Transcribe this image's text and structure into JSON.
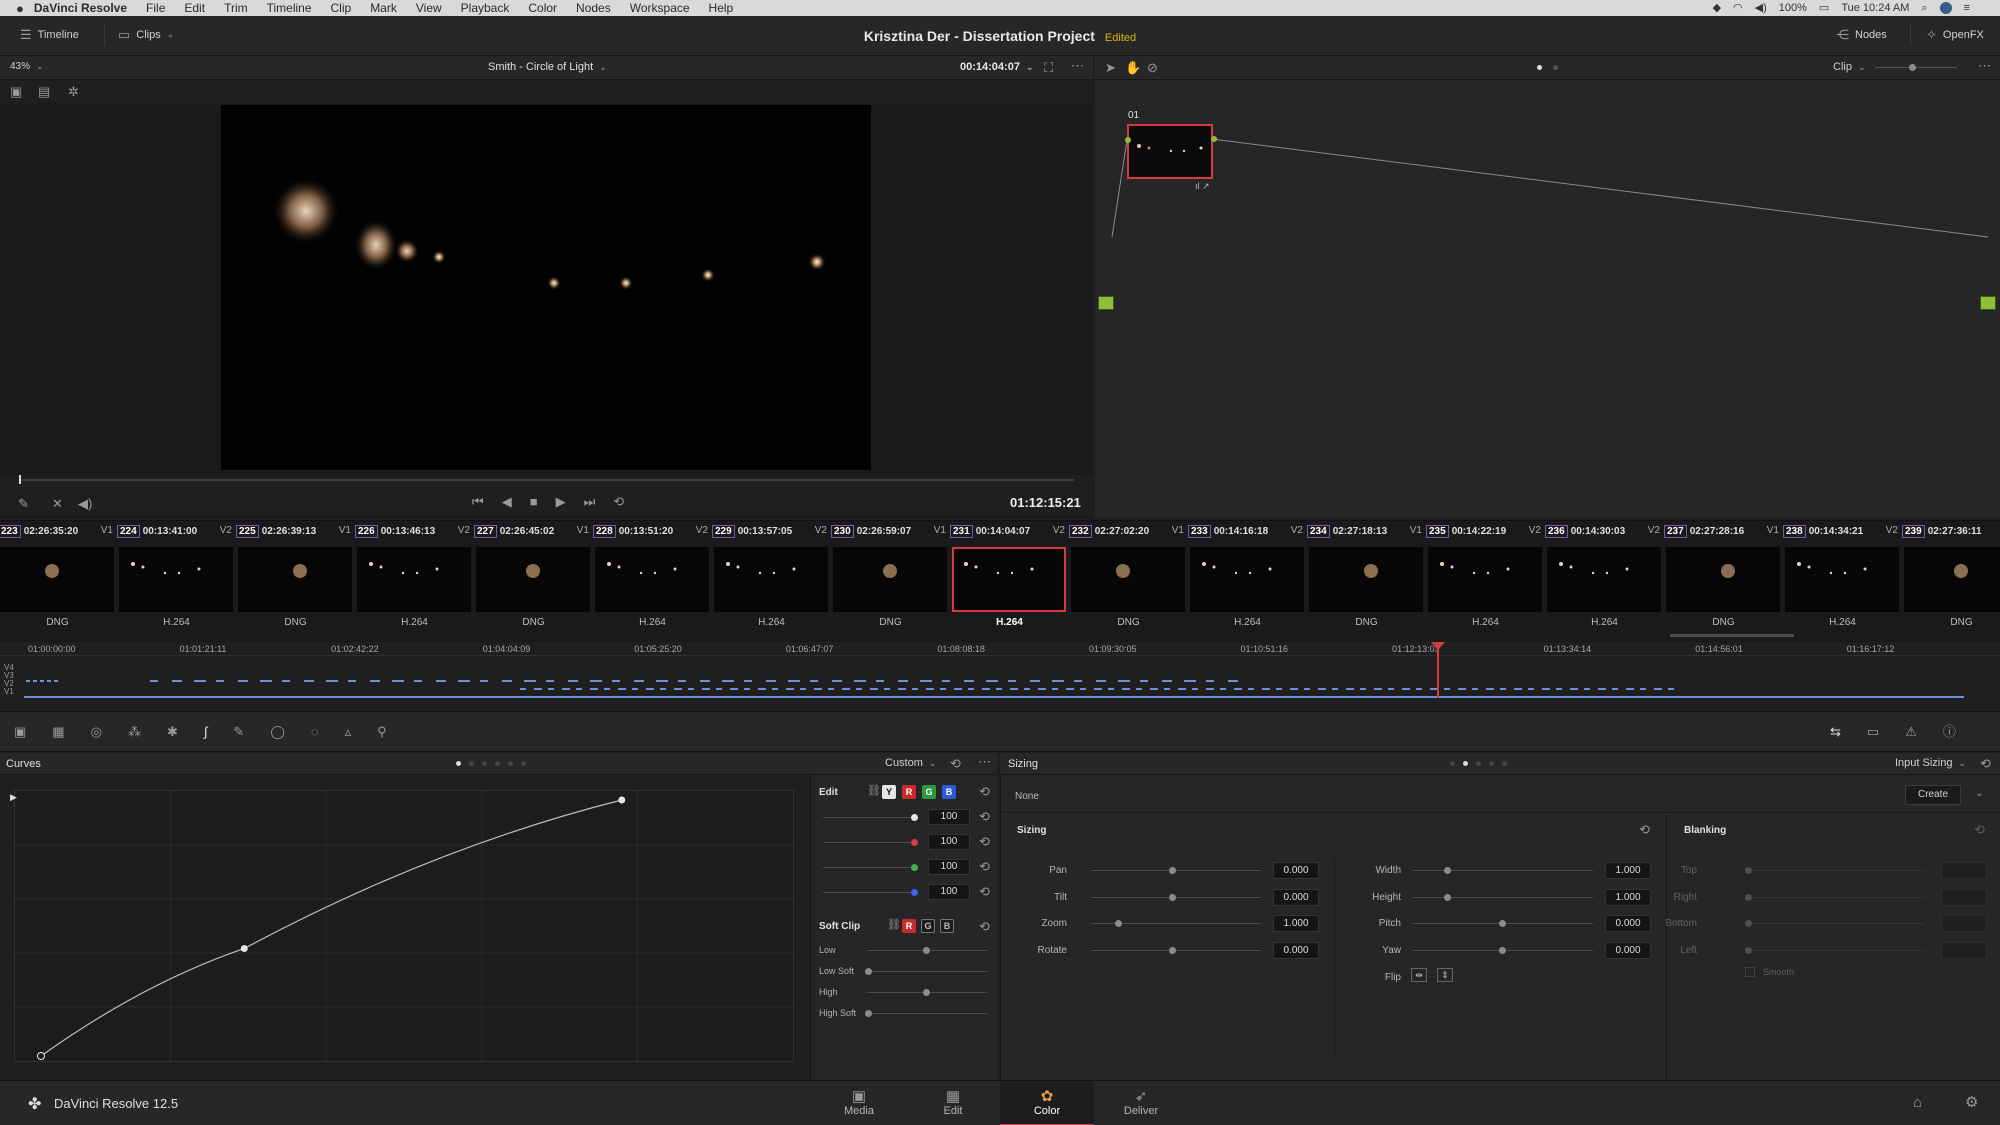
{
  "menubar": {
    "app": "DaVinci Resolve",
    "items": [
      "File",
      "Edit",
      "Trim",
      "Timeline",
      "Clip",
      "Mark",
      "View",
      "Playback",
      "Color",
      "Nodes",
      "Workspace",
      "Help"
    ],
    "battery": "100%",
    "clock": "Tue 10:24 AM"
  },
  "header": {
    "timeline_label": "Timeline",
    "clips_label": "Clips",
    "project_title": "Krisztina Der - Dissertation Project",
    "edited_label": "Edited",
    "nodes_label": "Nodes",
    "openfx_label": "OpenFX"
  },
  "viewer": {
    "zoom": "43%",
    "clip_name": "Smith - Circle of Light",
    "source_tc": "00:14:04:07",
    "record_tc": "01:12:15:21"
  },
  "nodes": {
    "mode": "Clip",
    "node_label": "01"
  },
  "thumbnails": [
    {
      "num": "223",
      "tc": "02:26:35:20",
      "track": "V1",
      "codec": "DNG"
    },
    {
      "num": "224",
      "tc": "00:13:41:00",
      "track": "V2",
      "codec": "H.264"
    },
    {
      "num": "225",
      "tc": "02:26:39:13",
      "track": "V1",
      "codec": "DNG"
    },
    {
      "num": "226",
      "tc": "00:13:46:13",
      "track": "V2",
      "codec": "H.264"
    },
    {
      "num": "227",
      "tc": "02:26:45:02",
      "track": "V1",
      "codec": "DNG"
    },
    {
      "num": "228",
      "tc": "00:13:51:20",
      "track": "V2",
      "codec": "H.264"
    },
    {
      "num": "229",
      "tc": "00:13:57:05",
      "track": "V2",
      "codec": "H.264"
    },
    {
      "num": "230",
      "tc": "02:26:59:07",
      "track": "V1",
      "codec": "DNG"
    },
    {
      "num": "231",
      "tc": "00:14:04:07",
      "track": "V2",
      "codec": "H.264"
    },
    {
      "num": "232",
      "tc": "02:27:02:20",
      "track": "V1",
      "codec": "DNG"
    },
    {
      "num": "233",
      "tc": "00:14:16:18",
      "track": "V2",
      "codec": "H.264"
    },
    {
      "num": "234",
      "tc": "02:27:18:13",
      "track": "V1",
      "codec": "DNG"
    },
    {
      "num": "235",
      "tc": "00:14:22:19",
      "track": "V2",
      "codec": "H.264"
    },
    {
      "num": "236",
      "tc": "00:14:30:03",
      "track": "V2",
      "codec": "H.264"
    },
    {
      "num": "237",
      "tc": "02:27:28:16",
      "track": "V1",
      "codec": "DNG"
    },
    {
      "num": "238",
      "tc": "00:14:34:21",
      "track": "V2",
      "codec": "H.264"
    },
    {
      "num": "239",
      "tc": "02:27:36:11",
      "track": "",
      "codec": "DNG"
    }
  ],
  "timeline": {
    "ruler": [
      "01:00:00:00",
      "01:01:21:11",
      "01:02:42:22",
      "01:04:04:09",
      "01:05:25:20",
      "01:06:47:07",
      "01:08:08:18",
      "01:09:30:05",
      "01:10:51:16",
      "01:12:13:03",
      "01:13:34:14",
      "01:14:56:01",
      "01:16:17:12"
    ],
    "tracks": [
      "V4",
      "V3",
      "V2",
      "V1"
    ]
  },
  "curves": {
    "title": "Curves",
    "preset": "Custom",
    "edit_label": "Edit",
    "channels": [
      "Y",
      "R",
      "G",
      "B"
    ],
    "intensities": [
      "100",
      "100",
      "100",
      "100"
    ],
    "soft_clip_label": "Soft Clip",
    "soft_clip_channels": [
      "R",
      "G",
      "B"
    ],
    "soft_clip_rows": [
      "Low",
      "Low Soft",
      "High",
      "High Soft"
    ],
    "points": [
      [
        0.0,
        0.0
      ],
      [
        0.28,
        0.42
      ],
      [
        0.8,
        1.0
      ]
    ]
  },
  "sizing": {
    "title": "Sizing",
    "mode": "Input Sizing",
    "preset": "None",
    "create_label": "Create",
    "section_label": "Sizing",
    "left_fields": [
      {
        "label": "Pan",
        "value": "0.000"
      },
      {
        "label": "Tilt",
        "value": "0.000"
      },
      {
        "label": "Zoom",
        "value": "1.000"
      },
      {
        "label": "Rotate",
        "value": "0.000"
      }
    ],
    "right_fields": [
      {
        "label": "Width",
        "value": "1.000"
      },
      {
        "label": "Height",
        "value": "1.000"
      },
      {
        "label": "Pitch",
        "value": "0.000"
      },
      {
        "label": "Yaw",
        "value": "0.000"
      }
    ],
    "flip_label": "Flip",
    "blanking_label": "Blanking",
    "blanking_fields": [
      "Top",
      "Right",
      "Bottom",
      "Left"
    ],
    "smooth_label": "Smooth"
  },
  "bottom": {
    "app_version": "DaVinci Resolve 12.5",
    "pages": [
      "Media",
      "Edit",
      "Color",
      "Deliver"
    ]
  },
  "colors": {
    "accent": "#d63b3b",
    "edited": "#d9b400",
    "node_green": "#8fbf3a",
    "timeline_clip": "#6f8fd8"
  }
}
